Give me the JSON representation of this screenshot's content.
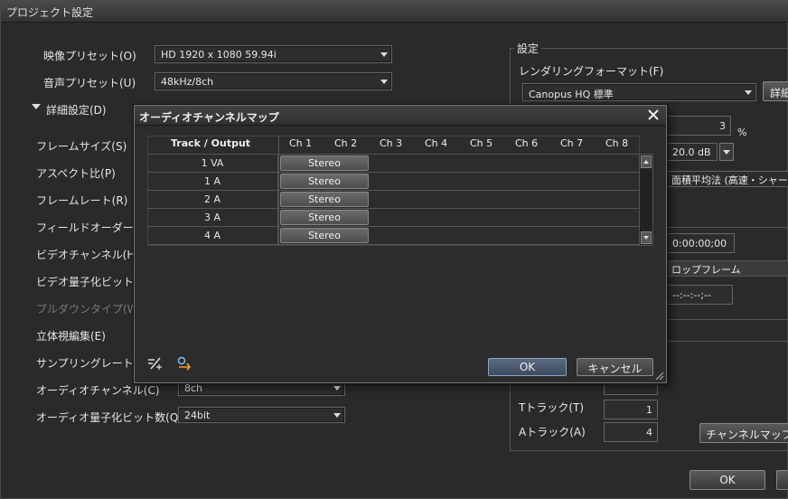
{
  "window": {
    "title": "プロジェクト設定"
  },
  "left": {
    "video_preset_label": "映像プリセット(O)",
    "video_preset_value": "HD 1920 x 1080 59.94i",
    "audio_preset_label": "音声プリセット(U)",
    "audio_preset_value": "48kHz/8ch",
    "details_label": "詳細設定(D)",
    "frame_size_label": "フレームサイズ(S)",
    "aspect_label": "アスペクト比(P)",
    "frame_rate_label": "フレームレート(R)",
    "field_order_label": "フィールドオーダー(O)",
    "video_channel_label": "ビデオチャンネル(H)",
    "video_bits_label": "ビデオ量子化ビット数(Z",
    "pulldown_label": "プルダウンタイプ(W)",
    "stereo_label": "立体視編集(E)",
    "sampling_label": "サンプリングレート(T)",
    "audio_channel_label": "オーディオチャンネル(C)",
    "audio_channel_value": "8ch",
    "audio_bits_label": "オーディオ量子化ビット数(Q)",
    "audio_bits_value": "24bit"
  },
  "right": {
    "group_title": "設定",
    "render_format_label": "レンダリングフォーマット(F)",
    "render_format_value": "Canopus HQ 標準",
    "detail_button": "詳細",
    "percent_value": "3",
    "percent_unit": "%",
    "db_value": "20.0 dB",
    "resample_value": "面積平均法 (高速・シャープ)",
    "timecode_value": "0:00:00;00",
    "dropframe_label": "ロップフレーム",
    "timecode2_value": "--:--:--;--",
    "t_track_label": "Tトラック(T)",
    "t_track_value": "1",
    "a_track_label": "Aトラック(A)",
    "a_track_value": "4",
    "channel_map_button": "チャンネルマップ",
    "ok_button": "OK"
  },
  "modal": {
    "title": "オーディオチャンネルマップ",
    "header_track": "Track / Output",
    "channels": [
      "Ch 1",
      "Ch 2",
      "Ch 3",
      "Ch 4",
      "Ch 5",
      "Ch 6",
      "Ch 7",
      "Ch 8"
    ],
    "rows": [
      {
        "track": "1 VA",
        "ch1": "Stereo"
      },
      {
        "track": "1 A",
        "ch1": "Stereo"
      },
      {
        "track": "2 A",
        "ch1": "Stereo"
      },
      {
        "track": "3 A",
        "ch1": "Stereo"
      },
      {
        "track": "4 A",
        "ch1": "Stereo"
      }
    ],
    "ok_button": "OK",
    "cancel_button": "キャンセル"
  }
}
